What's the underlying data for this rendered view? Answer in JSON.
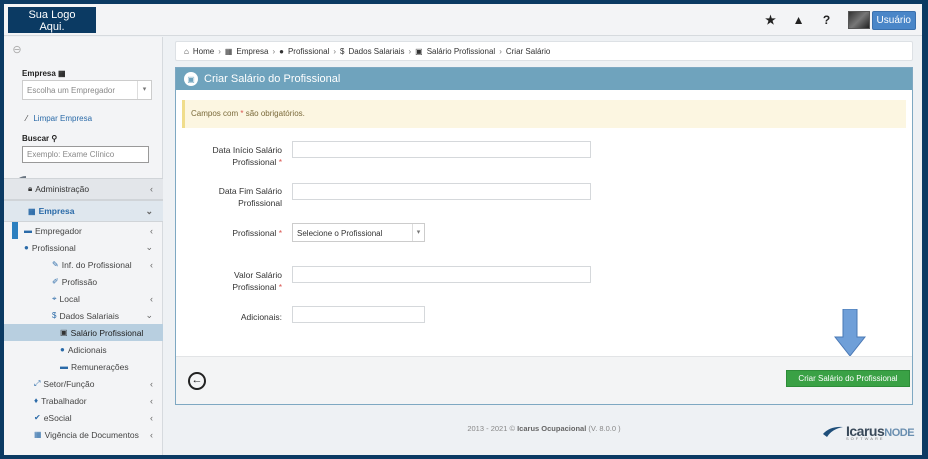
{
  "logo": {
    "line1": "Sua Logo",
    "line2": "Aqui."
  },
  "topbar": {
    "icons": [
      "star-icon",
      "warning-icon",
      "help-icon"
    ],
    "user_label": "Usuário"
  },
  "sidebar": {
    "empresa_label": "Empresa",
    "empresa_select": "Escolha um Empregador",
    "limpar_label": "Limpar Empresa",
    "buscar_label": "Buscar",
    "buscar_placeholder": "Exemplo: Exame Clínico",
    "menu": [
      {
        "label": "Administração",
        "icon": "lock-icon"
      },
      {
        "label": "Empresa",
        "icon": "building-icon"
      },
      {
        "label": "Empregador",
        "icon": "card-icon"
      },
      {
        "label": "Profissional",
        "icon": "user-icon"
      },
      {
        "label": "Inf. do Profissional",
        "icon": "pencil-icon"
      },
      {
        "label": "Profissão",
        "icon": "wrench-icon"
      },
      {
        "label": "Local",
        "icon": "map-pin-icon"
      },
      {
        "label": "Dados Salariais",
        "icon": "dollar-icon"
      },
      {
        "label": "Salário Profissional",
        "icon": "money-icon"
      },
      {
        "label": "Adicionais",
        "icon": "info-icon"
      },
      {
        "label": "Remunerações",
        "icon": "card-icon"
      },
      {
        "label": "Setor/Função",
        "icon": "arrows-icon"
      },
      {
        "label": "Trabalhador",
        "icon": "worker-icon"
      },
      {
        "label": "eSocial",
        "icon": "check-icon"
      },
      {
        "label": "Vigência de Documentos",
        "icon": "calendar-icon"
      }
    ]
  },
  "breadcrumb": [
    "Home",
    "Empresa",
    "Profissional",
    "Dados Salariais",
    "Salário Profissional",
    "Criar Salário"
  ],
  "panel": {
    "title": "Criar Salário do Profissional",
    "alert_prefix": "Campos com",
    "alert_star": "*",
    "alert_suffix": "são obrigatórios.",
    "fields": {
      "data_inicio": {
        "line1": "Data Início Salário",
        "line2": "Profissional",
        "required": "*"
      },
      "data_fim": {
        "line1": "Data Fim Salário",
        "line2": "Profissional"
      },
      "profissional": {
        "label": "Profissional",
        "required": "*",
        "select_value": "Selecione o Profissional"
      },
      "valor": {
        "line1": "Valor Salário",
        "line2": "Profissional",
        "required": "*"
      },
      "adicionais": {
        "label": "Adicionais:"
      }
    },
    "submit_label": "Criar Salário do Profissional"
  },
  "footer": {
    "text": "2013 - 2021 ©",
    "brand": "Icarus Ocupacional",
    "version": "(V. 8.0.0 )"
  },
  "brand_logo": {
    "text": "Icarus",
    "suffix": "NODE",
    "sub": "SOFTWARE"
  },
  "colors": {
    "navy": "#0b3a63",
    "panel_head": "#6fa3bd",
    "submit": "#3aa145",
    "user_btn": "#4a86c8",
    "arrow": "#6f9fd8"
  }
}
